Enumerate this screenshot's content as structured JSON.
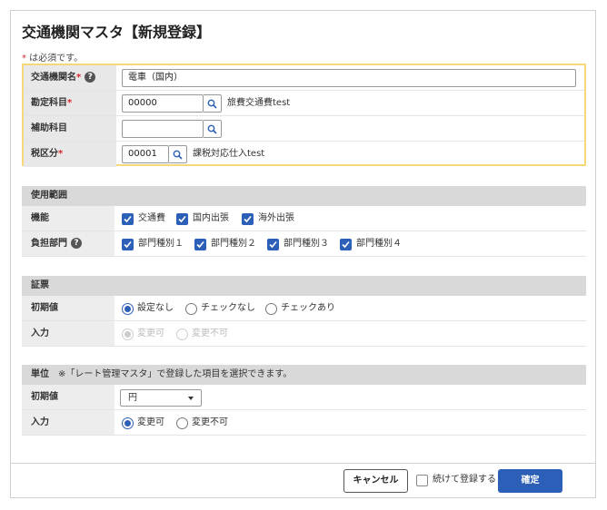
{
  "title": "交通機関マスタ【新規登録】",
  "required_note": {
    "star": "*",
    "text": " は必須です。"
  },
  "required_fields": {
    "name": {
      "label": "交通機関名",
      "star": "*",
      "help": "?",
      "value": "電車（国内）"
    },
    "account": {
      "label": "勘定科目",
      "star": "*",
      "value": "00000",
      "name": "旅費交通費test"
    },
    "sub_account": {
      "label": "補助科目",
      "value": ""
    },
    "tax": {
      "label": "税区分",
      "star": "*",
      "value": "00001",
      "name": "課税対応仕入test"
    }
  },
  "usage": {
    "heading": "使用範囲",
    "function": {
      "label": "機能",
      "options": [
        "交通費",
        "国内出張",
        "海外出張"
      ]
    },
    "department": {
      "label": "負担部門",
      "help": "?",
      "options": [
        "部門種別１",
        "部門種別２",
        "部門種別３",
        "部門種別４"
      ]
    }
  },
  "voucher": {
    "heading": "証票",
    "initial": {
      "label": "初期値",
      "options": [
        "設定なし",
        "チェックなし",
        "チェックあり"
      ],
      "selected": 0
    },
    "input": {
      "label": "入力",
      "options": [
        "変更可",
        "変更不可"
      ],
      "selected": 0
    }
  },
  "unit": {
    "heading": "単位",
    "note": "※「レート管理マスタ」で登録した項目を選択できます。",
    "initial": {
      "label": "初期値",
      "value": "円"
    },
    "input": {
      "label": "入力",
      "options": [
        "変更可",
        "変更不可"
      ],
      "selected": 0
    }
  },
  "footer": {
    "cancel": "キャンセル",
    "continue": "続けて登録する",
    "confirm": "確定"
  },
  "colors": {
    "accent": "#2c5fb8",
    "required_border": "#f4d87a",
    "required_star": "#d9262c"
  }
}
